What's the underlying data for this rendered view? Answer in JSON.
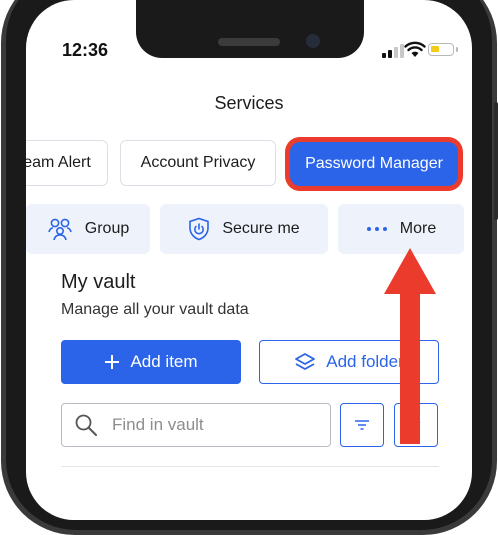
{
  "status_bar": {
    "time": "12:36"
  },
  "header": {
    "title": "Services"
  },
  "services": {
    "chips": [
      {
        "label": "eam Alert"
      },
      {
        "label": "Account Privacy"
      },
      {
        "label": "Password Manager",
        "active": true
      }
    ]
  },
  "quick_actions": [
    {
      "label": "Group",
      "icon": "group-icon"
    },
    {
      "label": "Secure me",
      "icon": "shield-power-icon"
    },
    {
      "label": "More",
      "icon": "more-dots-icon"
    }
  ],
  "vault": {
    "title": "My vault",
    "subtitle": "Manage all your vault data",
    "add_item_label": "Add item",
    "add_folder_label": "Add folder",
    "search_placeholder": "Find in vault"
  },
  "colors": {
    "accent": "#2b64e8",
    "highlight": "#ea3b2d",
    "quick_bg": "#eef3fb"
  }
}
